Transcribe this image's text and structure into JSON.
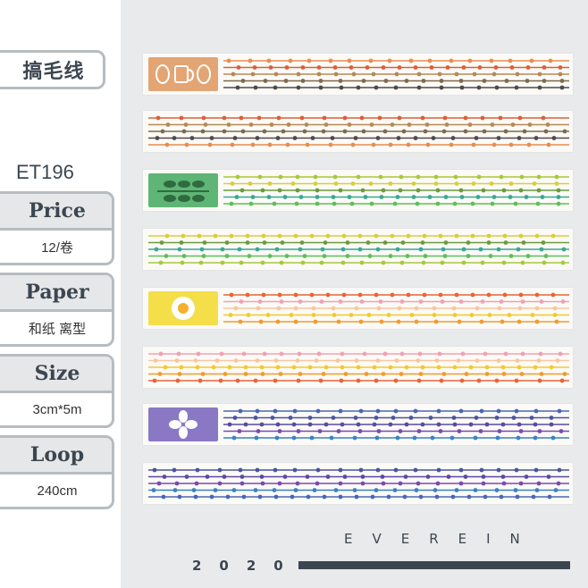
{
  "title": "搞毛线",
  "code": "ET196",
  "specs": {
    "price": {
      "label": "Price",
      "value": "12/卷"
    },
    "paper": {
      "label": "Paper",
      "value": "和纸 离型"
    },
    "size": {
      "label": "Size",
      "value": "3cm*5m"
    },
    "loop": {
      "label": "Loop",
      "value": "240cm"
    }
  },
  "brand": "EVEREIN",
  "year": "2020",
  "tape_colors": {
    "warm": [
      "#e88d4f",
      "#d9603a",
      "#b58a56",
      "#7f6a4d",
      "#4f4a4a"
    ],
    "green": [
      "#3aa88f",
      "#5fbf56",
      "#a8c83a",
      "#d7cf3a",
      "#6d9a3c"
    ],
    "yellow": [
      "#f2a0b5",
      "#f7c7a0",
      "#f2c92f",
      "#f29b2d",
      "#e8643a"
    ],
    "blue": [
      "#3a82c4",
      "#4a66b8",
      "#4a55a0",
      "#5a4aa0",
      "#7a4ab0"
    ]
  }
}
